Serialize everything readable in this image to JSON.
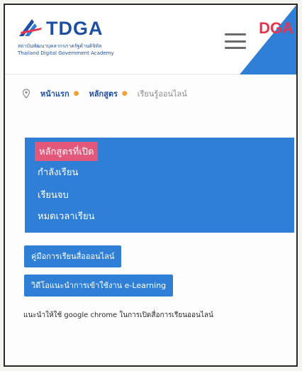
{
  "header": {
    "logo_text": "TDGA",
    "logo_subtitle_th": "สถาบันพัฒนาบุคลากรภาครัฐด้านดิจิทัล",
    "logo_subtitle_en": "Thailand Digital Government Academy",
    "corner_logo_text": "DGA",
    "menu_icon": "hamburger-icon"
  },
  "breadcrumb": {
    "icon": "location-pin-icon",
    "items": [
      "หน้าแรก",
      "หลักสูตร"
    ],
    "current": "เรียนรู้ออนไลน์"
  },
  "menu": {
    "items": [
      {
        "label": "หลักสูตรที่เปิด",
        "active": true
      },
      {
        "label": "กำลังเรียน",
        "active": false
      },
      {
        "label": "เรียนจบ",
        "active": false
      },
      {
        "label": "หมดเวลาเรียน",
        "active": false
      }
    ]
  },
  "buttons": {
    "guide": "คู่มือการเรียนสื่อออนไลน์",
    "video": "วิดีโอแนะนำการเข้าใช้งาน e-Learning"
  },
  "note": "แนะนำให้ใช้ google chrome ในการเปิดสื่อการเรียนออนไลน์",
  "colors": {
    "brand_blue": "#1e4fa3",
    "menu_blue": "#2f7fd6",
    "active_pink": "#e2577a",
    "breadcrumb_sep": "#f2a03a",
    "dga_red": "#e8344c"
  }
}
